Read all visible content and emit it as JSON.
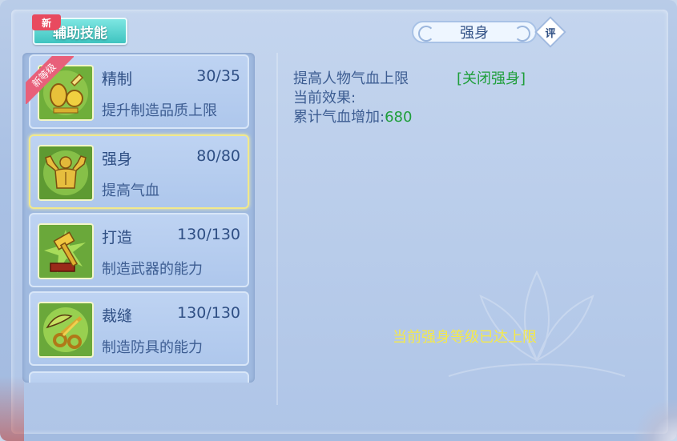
{
  "category": {
    "new_tag": "新",
    "label": "辅助技能"
  },
  "skills": [
    {
      "name": "精制",
      "level": "30/35",
      "desc": "提升制造品质上限",
      "ribbon": "新等级",
      "icon": "refine-icon"
    },
    {
      "name": "强身",
      "level": "80/80",
      "desc": "提高气血",
      "icon": "strength-icon"
    },
    {
      "name": "打造",
      "level": "130/130",
      "desc": "制造武器的能力",
      "icon": "forge-hammer-icon"
    },
    {
      "name": "裁缝",
      "level": "130/130",
      "desc": "制造防具的能力",
      "icon": "tailor-scissors-icon"
    }
  ],
  "detail": {
    "title": "强身",
    "review_badge": "评",
    "line1": "提高人物气血上限",
    "close_action": "[关闭强身]",
    "line2": "当前效果:",
    "line3_label": "累计气血增加:",
    "line3_value": "680",
    "max_message": "当前强身等级已达上限"
  },
  "colors": {
    "accent_teal": "#3fc4c0",
    "green_value": "#1e9e3a",
    "yellow_message": "#f5e94a",
    "selected_border": "#f2e98a"
  }
}
